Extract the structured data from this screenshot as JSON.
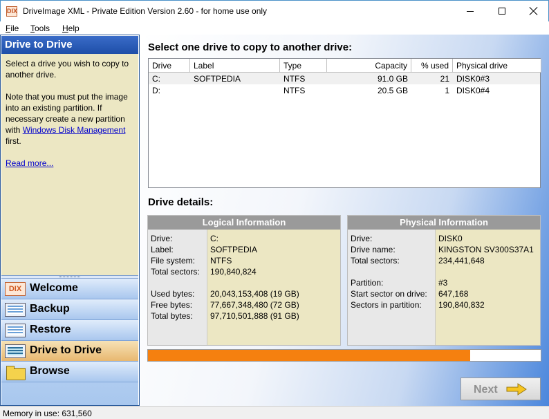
{
  "window": {
    "title": "DriveImage XML - Private Edition Version 2.60 - for home use only",
    "app_icon": "DIX"
  },
  "menu": {
    "file": {
      "accel": "F",
      "rest": "ile"
    },
    "tools": {
      "accel": "T",
      "rest": "ools"
    },
    "help": {
      "accel": "H",
      "rest": "elp"
    }
  },
  "left": {
    "header": "Drive to Drive",
    "para1": "Select a drive you wish to copy to another drive.",
    "para2_a": "Note that you must put the image into an existing partition. If necessary create a new partition with ",
    "para2_link": "Windows Disk Management",
    "para2_b": " first.",
    "read_more": "Read more...",
    "nav": [
      {
        "label": "Welcome",
        "icon": "dix-logo-icon",
        "icon_text": "DIX"
      },
      {
        "label": "Backup",
        "icon": "backup-icon"
      },
      {
        "label": "Restore",
        "icon": "restore-icon"
      },
      {
        "label": "Drive to Drive",
        "icon": "drive-to-drive-icon"
      },
      {
        "label": "Browse",
        "icon": "folder-icon"
      }
    ]
  },
  "main": {
    "select_title": "Select one drive to copy to another drive:",
    "columns": [
      "Drive",
      "Label",
      "Type",
      "Capacity",
      "% used",
      "Physical drive"
    ],
    "rows": [
      {
        "drive": "C:",
        "label": "SOFTPEDIA",
        "type": "NTFS",
        "capacity": "91.0 GB",
        "used": "21",
        "physical": "DISK0#3"
      },
      {
        "drive": "D:",
        "label": "",
        "type": "NTFS",
        "capacity": "20.5 GB",
        "used": "1",
        "physical": "DISK0#4"
      }
    ],
    "details_title": "Drive details:",
    "logical": {
      "header": "Logical Information",
      "labels": [
        "Drive:",
        "Label:",
        "File system:",
        "Total sectors:",
        "Used bytes:",
        "Free bytes:",
        "Total bytes:"
      ],
      "values": [
        "C:",
        "SOFTPEDIA",
        "NTFS",
        "190,840,824",
        "20,043,153,408 (19 GB)",
        "77,667,348,480 (72 GB)",
        "97,710,501,888 (91 GB)"
      ]
    },
    "physical": {
      "header": "Physical Information",
      "labels": [
        "Drive:",
        "Drive name:",
        "Total sectors:",
        "Partition:",
        "Start sector on drive:",
        "Sectors in partition:"
      ],
      "values": [
        "DISK0",
        "KINGSTON SV300S37A1",
        "234,441,648",
        "#3",
        "647,168",
        "190,840,832"
      ]
    },
    "progress_fraction": 0.82,
    "next_label": "Next",
    "colors": {
      "progress": "#f5800f",
      "nav_active": "#e8b870",
      "header_blue": "#1e4ea8"
    }
  },
  "status": {
    "memory": "Memory in use: 631,560"
  }
}
